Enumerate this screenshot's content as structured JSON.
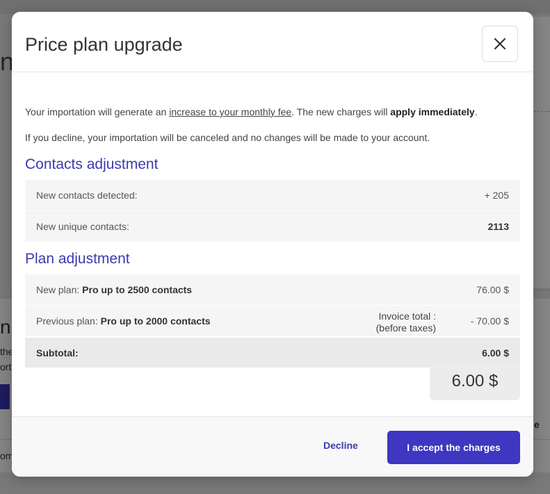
{
  "modal": {
    "title": "Price plan upgrade",
    "intro": {
      "part1": "Your importation will generate an ",
      "link": "increase to your monthly fee",
      "part2": ". The new charges will ",
      "bold": "apply immediately",
      "part3": "."
    },
    "decline_notice": "If you decline, your importation will be canceled and no changes will be made to your account.",
    "contacts_section": {
      "title": "Contacts adjustment",
      "rows": [
        {
          "label": "New contacts detected:",
          "value": "+ 205"
        },
        {
          "label": "New unique contacts:",
          "value": "2113"
        }
      ]
    },
    "plan_section": {
      "title": "Plan adjustment",
      "new_plan": {
        "prefix": "New plan: ",
        "name": "Pro up to 2500 contacts",
        "value": "76.00 $"
      },
      "previous_plan": {
        "prefix": "Previous plan: ",
        "name": "Pro up to 2000 contacts",
        "value": "- 70.00 $"
      },
      "subtotal": {
        "label": "Subtotal:",
        "value": "6.00 $"
      }
    },
    "invoice": {
      "label_line1": "Invoice total :",
      "label_line2": "(before taxes)",
      "value": "6.00 $"
    },
    "footer": {
      "decline_label": "Decline",
      "accept_label": "I accept the charges"
    }
  },
  "background": {
    "partial_text_1": "nt",
    "partial_text_2": "n",
    "partial_text_3": "the",
    "partial_text_4": "ort.",
    "partial_text_5": "om",
    "partial_text_6": "e"
  },
  "colors": {
    "accent": "#3d3aaf",
    "button": "#3d37c2"
  }
}
